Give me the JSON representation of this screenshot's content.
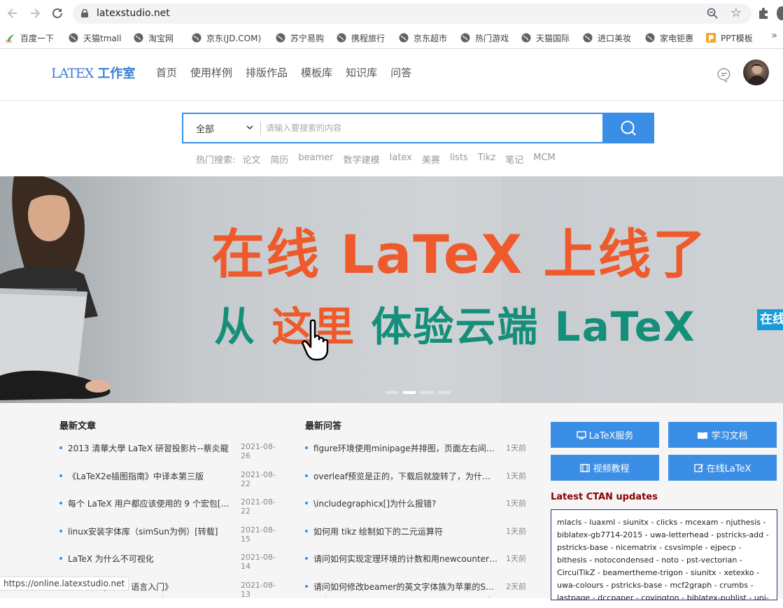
{
  "browser": {
    "url": "latexstudio.net",
    "status_url": "https://online.latexstudio.net",
    "bookmarks": [
      {
        "label": "百度一下",
        "icon": "hao-icon"
      },
      {
        "label": "天猫tmall",
        "icon": "globe-icon"
      },
      {
        "label": "淘宝网",
        "icon": "globe-icon"
      },
      {
        "label": "京东(JD.COM)",
        "icon": "globe-icon"
      },
      {
        "label": "苏宁易购",
        "icon": "globe-icon"
      },
      {
        "label": "携程旅行",
        "icon": "globe-icon"
      },
      {
        "label": "京东超市",
        "icon": "globe-icon"
      },
      {
        "label": "热门游戏",
        "icon": "globe-icon"
      },
      {
        "label": "天猫国际",
        "icon": "globe-icon"
      },
      {
        "label": "进口美妆",
        "icon": "globe-icon"
      },
      {
        "label": "家电钜惠",
        "icon": "globe-icon"
      },
      {
        "label": "PPT模板",
        "icon": "ppt-icon"
      }
    ],
    "more": "»"
  },
  "site": {
    "logo_latex": "LATEX",
    "logo_studio": "工作室",
    "nav": [
      "首页",
      "使用样例",
      "排版作品",
      "模板库",
      "知识库",
      "问答"
    ]
  },
  "search": {
    "scope": "全部",
    "placeholder": "请输入要搜索的内容",
    "hot_label": "热门搜索:",
    "hot_terms": [
      "论文",
      "简历",
      "beamer",
      "数学建模",
      "latex",
      "美赛",
      "lists",
      "Tikz",
      "笔记",
      "MCM"
    ]
  },
  "banner": {
    "headline": "在线 LaTeX 上线了",
    "sub_prefix": "从 ",
    "sub_accent": "这里",
    "sub_suffix": "体验云端 LaTeX",
    "side_tag": "在线",
    "slides": 4,
    "active_slide": 2,
    "colors": {
      "headline": "#ee5a2c",
      "sub": "#168f7a"
    }
  },
  "articles": {
    "title": "最新文章",
    "items": [
      {
        "title": "2013 清華大學 LaTeX 研習投影片--蔡炎龍",
        "date": "2021-08-26"
      },
      {
        "title": "《LaTeX2e插图指南》中译本第三版",
        "date": "2021-08-22"
      },
      {
        "title": "每个 LaTeX 用户都应该使用的 9 个宏包[投稿]",
        "date": "2021-08-22"
      },
      {
        "title": "linux安装字体库（simSun为例）[转载]",
        "date": "2021-08-15"
      },
      {
        "title": "LaTeX 为什么不可视化",
        "date": "2021-08-14"
      },
      {
        "title": "生物信息学 Perl 语言入门》",
        "date": "2021-08-13"
      }
    ]
  },
  "questions": {
    "title": "最新问答",
    "items": [
      {
        "title": "figure环境使用minipage并排图，页面左右间距不...",
        "time": "1天前"
      },
      {
        "title": "overleaf预览是正的，下载后就旋转了，为什么呢?",
        "time": "1天前"
      },
      {
        "title": "\\includegraphicx[]为什么报错?",
        "time": "1天前"
      },
      {
        "title": "如何用 tikz 绘制如下的二元运算符",
        "time": "1天前"
      },
      {
        "title": "请问如何实现定理环境的计数和用newcounter新...",
        "time": "1天前"
      },
      {
        "title": "请问如何修改beamer的英文字体族为苹果的SF M...",
        "time": "2天前"
      }
    ]
  },
  "services": [
    {
      "label": "LaTeX服务",
      "icon": "monitor-icon"
    },
    {
      "label": "学习文档",
      "icon": "book-icon"
    },
    {
      "label": "视频教程",
      "icon": "film-icon"
    },
    {
      "label": "在线LaTeX",
      "icon": "edit-icon"
    }
  ],
  "ctan": {
    "title": "Latest CTAN updates",
    "text": "mlacls - luaxml - siunitx - clicks - mcexam - njuthesis - biblatex-gb7714-2015 - uwa-letterhead - pstricks-add - pstricks-base - nicematrix - csvsimple - ejpecp - bithesis - notocondensed - noto - pst-vectorian - CircuiTikZ - beamertheme-trigon - siunitx - xetexko - uwa-colours - pstricks-base - mcf2graph - crumbs - lastpage - dccpaper - covington - biblatex-publist - uni-"
  }
}
